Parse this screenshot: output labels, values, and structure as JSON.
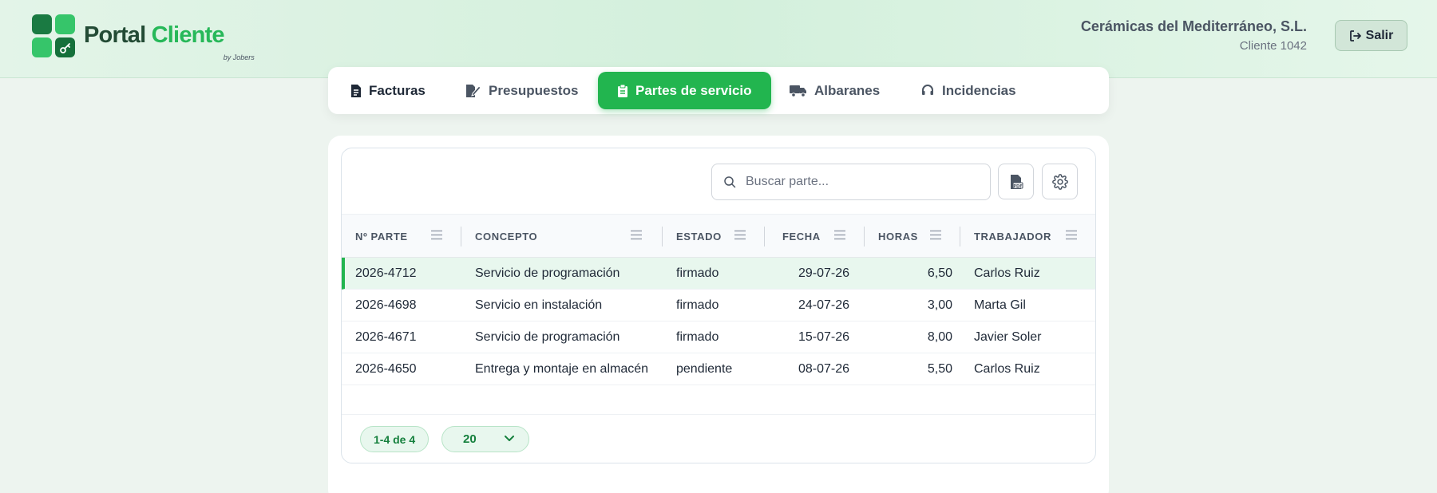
{
  "header": {
    "logo": {
      "title_part1": "Portal",
      "title_part2": "Cliente",
      "byline": "by Jobers"
    },
    "company_name": "Cerámicas del Mediterráneo, S.L.",
    "client_label": "Cliente 1042",
    "logout_label": "Salir"
  },
  "tabs": [
    {
      "label": "Facturas",
      "icon": "invoice-icon"
    },
    {
      "label": "Presupuestos",
      "icon": "quote-edit-icon"
    },
    {
      "label": "Partes de servicio",
      "icon": "clipboard-icon",
      "active": true
    },
    {
      "label": "Albaranes",
      "icon": "truck-icon"
    },
    {
      "label": "Incidencias",
      "icon": "headset-icon"
    }
  ],
  "toolbar": {
    "search_placeholder": "Buscar parte...",
    "pdf_icon": "pdf-export-icon",
    "settings_icon": "gear-icon"
  },
  "table": {
    "columns": [
      "Nº PARTE",
      "CONCEPTO",
      "ESTADO",
      "FECHA",
      "HORAS",
      "TRABAJADOR"
    ],
    "rows": [
      {
        "numero": "2026-4712",
        "concepto": "Servicio de programación",
        "estado": "firmado",
        "fecha": "29-07-26",
        "horas": "6,50",
        "trabajador": "Carlos Ruiz",
        "selected": true
      },
      {
        "numero": "2026-4698",
        "concepto": "Servicio en instalación",
        "estado": "firmado",
        "fecha": "24-07-26",
        "horas": "3,00",
        "trabajador": "Marta Gil"
      },
      {
        "numero": "2026-4671",
        "concepto": "Servicio de programación",
        "estado": "firmado",
        "fecha": "15-07-26",
        "horas": "8,00",
        "trabajador": "Javier Soler"
      },
      {
        "numero": "2026-4650",
        "concepto": "Entrega y montaje en almacén",
        "estado": "pendiente",
        "fecha": "08-07-26",
        "horas": "5,50",
        "trabajador": "Carlos Ruiz"
      }
    ]
  },
  "pagination": {
    "range_label": "1-4 de 4",
    "page_size": "20"
  },
  "colors": {
    "accent": "#22b54f",
    "brand_dark": "#234b35",
    "selected_row": "#e8f7ee"
  }
}
